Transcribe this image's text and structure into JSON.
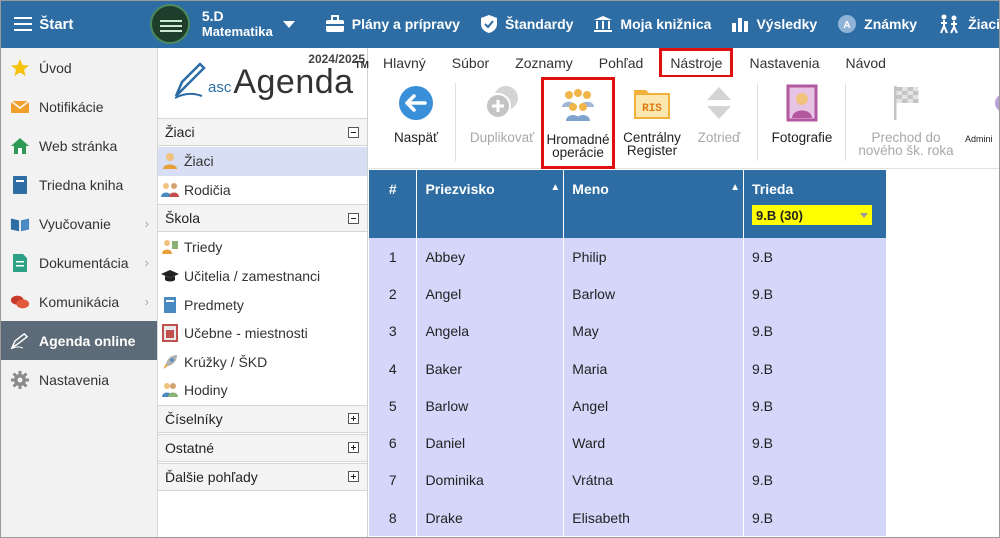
{
  "topbar": {
    "start_label": "Štart",
    "class_name": "5.D",
    "subject": "Matematika",
    "nav": [
      {
        "label": "Plány a prípravy",
        "icon": "briefcase-icon"
      },
      {
        "label": "Štandardy",
        "icon": "shield-check-icon"
      },
      {
        "label": "Moja knižnica",
        "icon": "library-icon"
      },
      {
        "label": "Výsledky",
        "icon": "bar-chart-icon"
      },
      {
        "label": "Známky",
        "icon": "grade-badge-icon"
      },
      {
        "label": "Žiaci",
        "icon": "students-walking-icon"
      }
    ]
  },
  "sidebar": {
    "items": [
      {
        "label": "Úvod",
        "icon": "star-icon"
      },
      {
        "label": "Notifikácie",
        "icon": "envelope-icon"
      },
      {
        "label": "Web stránka",
        "icon": "house-icon"
      },
      {
        "label": "Triedna kniha",
        "icon": "book-icon"
      },
      {
        "label": "Vyučovanie",
        "icon": "open-book-icon"
      },
      {
        "label": "Dokumentácia",
        "icon": "document-icon"
      },
      {
        "label": "Komunikácia",
        "icon": "chat-bubbles-icon"
      },
      {
        "label": "Agenda online",
        "icon": "pen-icon"
      },
      {
        "label": "Nastavenia",
        "icon": "gear-icon"
      }
    ]
  },
  "panel": {
    "year": "2024/2025",
    "logo_asc": "asc",
    "logo_agenda": "Agenda",
    "logo_tm": "TM",
    "groups": [
      {
        "label": "Žiaci",
        "items": [
          "Žiaci",
          "Rodičia"
        ]
      },
      {
        "label": "Škola",
        "items": [
          "Triedy",
          "Učitelia / zamestnanci",
          "Predmety",
          "Učebne - miestnosti",
          "Krúžky / ŠKD",
          "Hodiny"
        ]
      },
      {
        "label": "Číselníky",
        "items": []
      },
      {
        "label": "Ostatné",
        "items": []
      },
      {
        "label": "Ďalšie pohľady",
        "items": []
      }
    ]
  },
  "menu": {
    "tabs": [
      "Hlavný",
      "Súbor",
      "Zoznamy",
      "Pohľad",
      "Nástroje",
      "Nastavenia",
      "Návod"
    ]
  },
  "ribbon": {
    "back": "Naspäť",
    "duplicate": "Duplikovať",
    "bulk_line1": "Hromadné",
    "bulk_line2": "operácie",
    "ris_line1": "Centrálny",
    "ris_line2": "Register",
    "ris_icon_text": "RIS",
    "sort": "Zotrieď",
    "photos": "Fotografie",
    "transition_line1": "Prechod do",
    "transition_line2": "nového šk. roka",
    "admin": "Admini"
  },
  "table": {
    "headers": {
      "num": "#",
      "surname": "Priezvisko",
      "name": "Meno",
      "class": "Trieda"
    },
    "filter_value": "9.B (30)",
    "rows": [
      {
        "num": "1",
        "surname": "Abbey",
        "name": "Philip",
        "class": "9.B"
      },
      {
        "num": "2",
        "surname": "Angel",
        "name": "Barlow",
        "class": "9.B"
      },
      {
        "num": "3",
        "surname": "Angela",
        "name": "May",
        "class": "9.B"
      },
      {
        "num": "4",
        "surname": "Baker",
        "name": "Maria",
        "class": "9.B"
      },
      {
        "num": "5",
        "surname": "Barlow",
        "name": "Angel",
        "class": "9.B"
      },
      {
        "num": "6",
        "surname": "Daniel",
        "name": "Ward",
        "class": "9.B"
      },
      {
        "num": "7",
        "surname": "Dominika",
        "name": "Vrátna",
        "class": "9.B"
      },
      {
        "num": "8",
        "surname": "Drake",
        "name": "Elisabeth",
        "class": "9.B"
      }
    ]
  }
}
